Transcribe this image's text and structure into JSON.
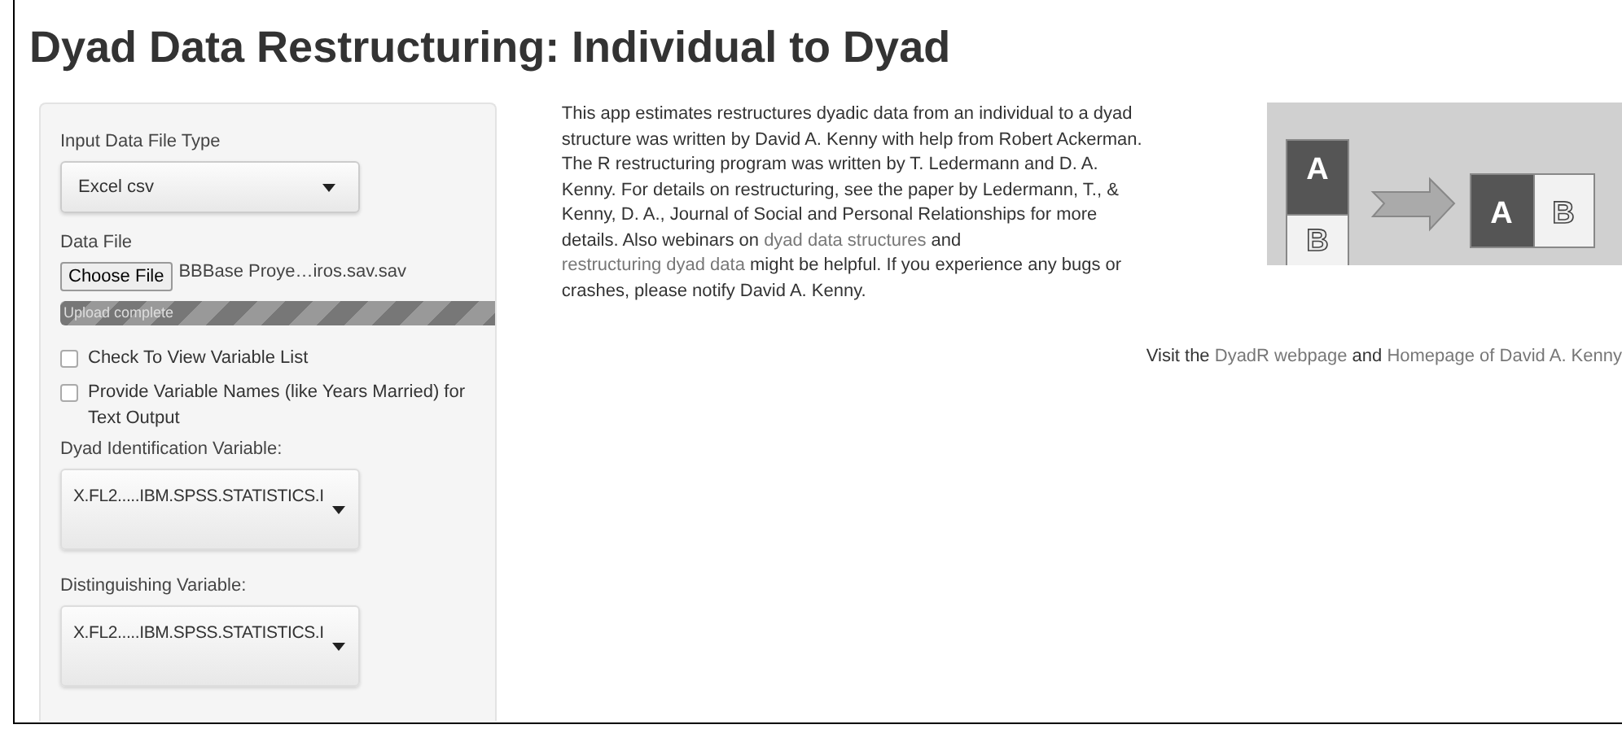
{
  "title": "Dyad Data Restructuring: Individual to Dyad",
  "sidebar": {
    "file_type": {
      "label": "Input Data File Type",
      "value": "Excel csv"
    },
    "data_file": {
      "label": "Data File",
      "button": "Choose File",
      "filename": "BBBase Proye…iros.sav.sav",
      "progress": {
        "text": "Upload complete",
        "level": 1
      }
    },
    "checkboxes": [
      {
        "label": "Check To View Variable List",
        "checked": false
      },
      {
        "label": "Provide Variable Names (like Years Married) for Text Output",
        "checked": false
      }
    ],
    "selects": [
      {
        "label": "Dyad Identification Variable:",
        "value": "X.FL2.....IBM.SPSS.STATISTICS.I"
      },
      {
        "label": "Distinguishing Variable:",
        "value": "X.FL2.....IBM.SPSS.STATISTICS.I"
      }
    ]
  },
  "description": [
    {
      "kind": "text",
      "text": "This app estimates restructures dyadic data from an individual to a dyad structure was written by David A. Kenny with help from Robert Ackerman. The R restructuring program was written by T. Ledermann and D. A. Kenny. For details on restructuring, see the paper by Ledermann, T., & Kenny, D. A., Journal of Social and Personal Relationships for more details. Also webinars on "
    },
    {
      "kind": "link",
      "text": "dyad data structures"
    },
    {
      "kind": "text",
      "text": " and "
    },
    {
      "kind": "link",
      "text": "restructuring dyad data"
    },
    {
      "kind": "text",
      "text": " might be helpful. If you experience any bugs or crashes, please notify David A. Kenny."
    }
  ],
  "diagram": {
    "letters": [
      "A",
      "B",
      "A",
      "B"
    ]
  },
  "footer": [
    {
      "kind": "text",
      "text": "Visit the "
    },
    {
      "kind": "link",
      "text": "DyadR webpage"
    },
    {
      "kind": "text",
      "text": " and "
    },
    {
      "kind": "link",
      "text": "Homepage of David A. Kenny"
    }
  ]
}
